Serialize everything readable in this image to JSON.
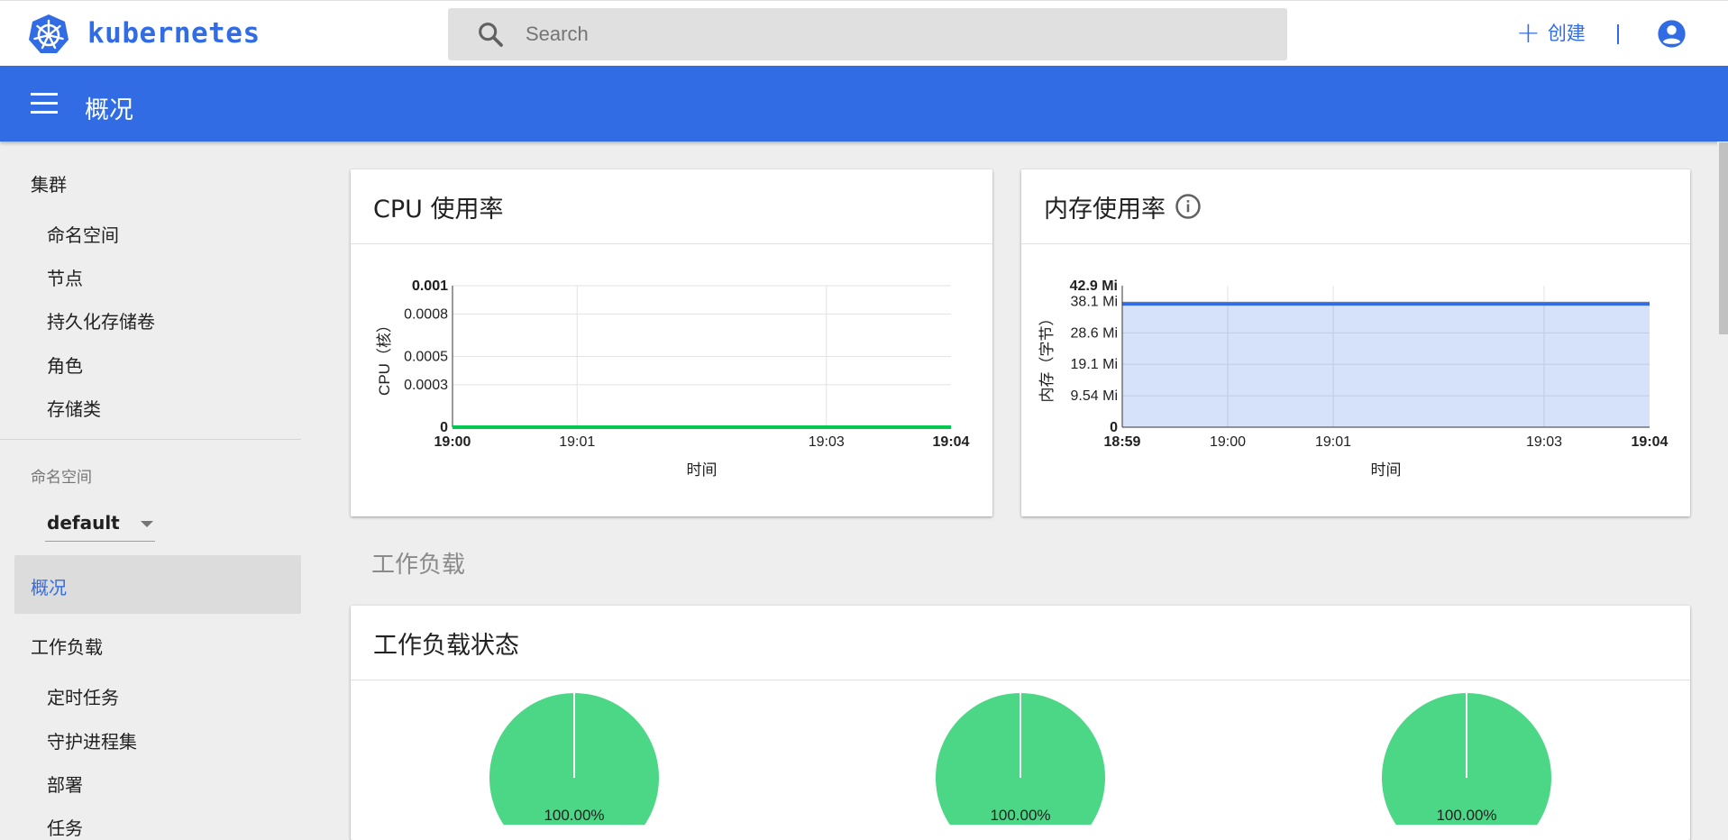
{
  "header": {
    "brand": "kubernetes",
    "search_placeholder": "Search",
    "create_label": "创建",
    "icons": {
      "logo": "kubernetes-wheel-icon",
      "search": "search-icon",
      "account": "account-circle-icon"
    },
    "accent_color": "#326ce5"
  },
  "toolbar": {
    "title": "概况"
  },
  "sidebar": {
    "cluster_heading": "集群",
    "cluster_items": [
      "命名空间",
      "节点",
      "持久化存储卷",
      "角色",
      "存储类"
    ],
    "namespace_label": "命名空间",
    "namespace_value": "default",
    "active_item": "概况",
    "workloads_heading": "工作负载",
    "workload_items": [
      "定时任务",
      "守护进程集",
      "部署",
      "任务"
    ]
  },
  "main": {
    "cpu_card_title": "CPU 使用率",
    "memory_card_title": "内存使用率",
    "workloads_section_title": "工作负载",
    "workload_status_title": "工作负载状态",
    "pie_color": "#4cd787"
  },
  "chart_data": [
    {
      "type": "area",
      "title": "CPU 使用率",
      "xlabel": "时间",
      "ylabel": "CPU（核）",
      "x_ticks": [
        "19:00",
        "19:01",
        "19:03",
        "19:04"
      ],
      "y_ticks": [
        "0",
        "0.0003",
        "0.0005",
        "0.0008",
        "0.001",
        "0.001"
      ],
      "ylim": [
        0,
        0.001
      ],
      "grid": true,
      "series": [
        {
          "x": [
            "19:00",
            "19:01",
            "19:02",
            "19:03",
            "19:04"
          ],
          "values": [
            0,
            0,
            0,
            0,
            0
          ],
          "color": "#00c752"
        }
      ]
    },
    {
      "type": "area",
      "title": "内存使用率",
      "xlabel": "时间",
      "ylabel": "内存（字节）",
      "x_ticks": [
        "18:59",
        "19:00",
        "19:01",
        "19:03",
        "19:04"
      ],
      "y_ticks": [
        "0",
        "9.54 Mi",
        "19.1 Mi",
        "28.6 Mi",
        "38.1 Mi",
        "42.9 Mi"
      ],
      "ylim": [
        0,
        42.9
      ],
      "grid": true,
      "series": [
        {
          "x": [
            "18:59",
            "19:00",
            "19:01",
            "19:02",
            "19:03",
            "19:04"
          ],
          "values": [
            37.4,
            37.4,
            37.4,
            37.4,
            37.4,
            37.4
          ],
          "color": "#326ce5"
        }
      ]
    },
    {
      "type": "pie",
      "title": "工作负载状态",
      "charts": [
        {
          "values": [
            100
          ],
          "label": "100.00%"
        },
        {
          "values": [
            100
          ],
          "label": "100.00%"
        },
        {
          "values": [
            100
          ],
          "label": "100.00%"
        }
      ]
    }
  ]
}
